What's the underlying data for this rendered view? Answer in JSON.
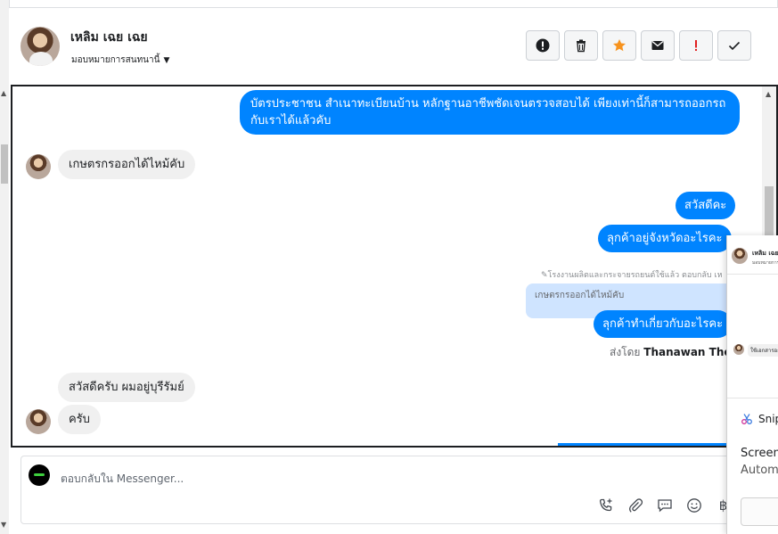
{
  "header": {
    "name": "เหลิม เฉย เฉย",
    "assign_label": "มอบหมายการสนทนานี้",
    "actions": [
      {
        "name": "follow-up-icon",
        "glyph": "!"
      },
      {
        "name": "trash-icon",
        "glyph": ""
      },
      {
        "name": "star-icon",
        "glyph": "★"
      },
      {
        "name": "envelope-icon",
        "glyph": ""
      },
      {
        "name": "spam-icon",
        "glyph": "!"
      },
      {
        "name": "check-icon",
        "glyph": "✓"
      }
    ]
  },
  "messages": {
    "m1": "บัตรประชาชน สำเนาทะเบียนบ้าน หลักฐานอาชีพชัดเจนตรวจสอบได้ เพียงเท่านี้ก็สามารถออกรถกับเราได้แล้วคับ",
    "m2": "เกษตรกรออกได้ไหม้คับ",
    "m3": "สวัสดีคะ",
    "m4": "ลุกค้าอยู่จังหวัดอะไรคะ",
    "reply_note": "โรงงานผลิตและกระจายรถยนต์ใช้แล้ว ตอบกลับ เห",
    "quoted": "เกษตรกรออกได้ไหม้คับ",
    "m5": "ลุกค้าทำเกี่ยวกับอะไรคะ",
    "sent_by_prefix": "ส่งโดย",
    "sent_by_name": "Thanawan Thon",
    "m6": "สวัสดีครับ ผมอยู่บุรีรัมย์",
    "m7": "ครับ"
  },
  "composer": {
    "placeholder": "ตอบกลับใน Messenger...",
    "tools": [
      "phone-plus-icon",
      "paperclip-icon",
      "saved-reply-icon",
      "emoji-icon",
      "baht-icon"
    ]
  },
  "popup": {
    "mini_name": "เหลิม เฉย",
    "mini_sub": "มอบหมายการสนท",
    "mini_msg": "ใช้เอกสารอะ",
    "snip_label": "Snip",
    "screen_title": "Screen",
    "screen_sub": "Autom"
  },
  "colors": {
    "outgoing_bubble": "#0084ff",
    "incoming_bubble": "#f0f0f0",
    "quoted_bubble": "#cfe4ff",
    "star": "#f7931e",
    "spam": "#e02020"
  }
}
